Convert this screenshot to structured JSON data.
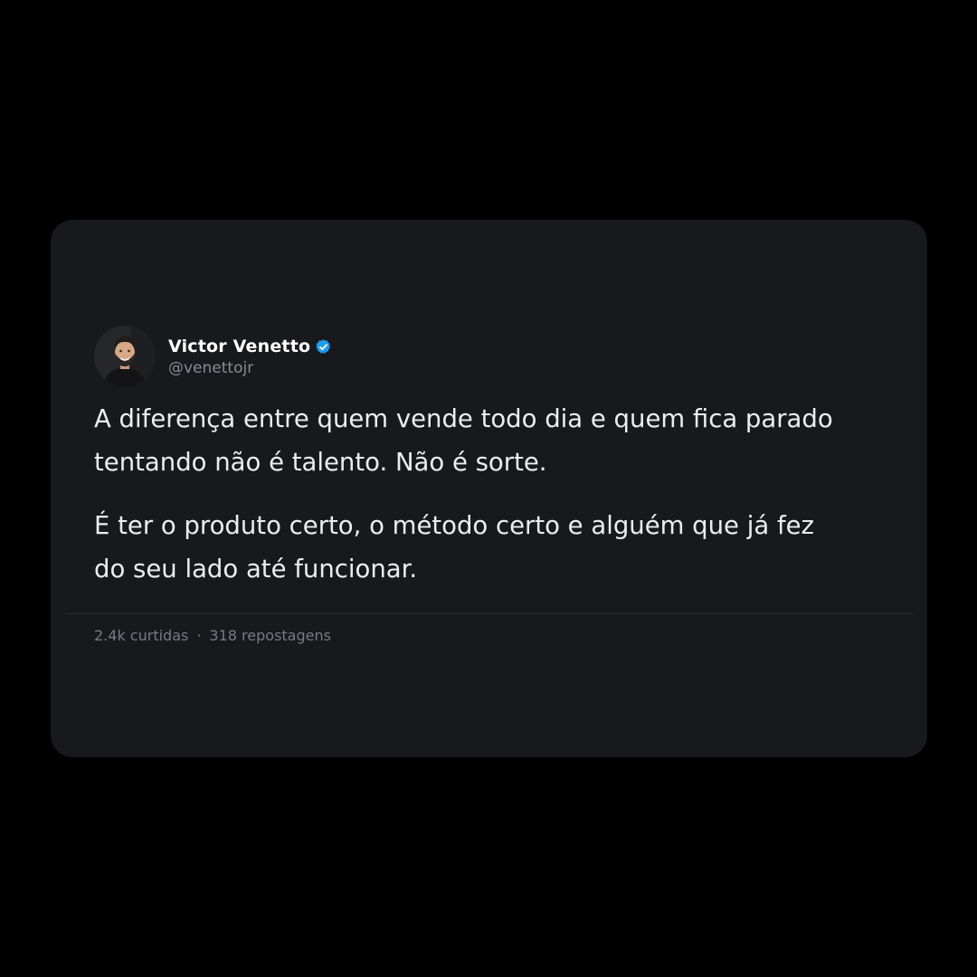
{
  "author": {
    "name": "Victor Venetto",
    "handle": "@venettojr",
    "verified": true,
    "verified_color": "#1d9bf0",
    "avatar_icon": "user-photo"
  },
  "post": {
    "paragraphs": [
      "A diferença entre quem vende todo dia e quem fica parado tentando não é talento. Não é sorte.",
      "É ter o produto certo, o método certo e alguém que já fez do seu lado até funcionar."
    ]
  },
  "stats": {
    "likes": "2.4k curtidas",
    "separator": "·",
    "reposts": "318 repostagens"
  },
  "colors": {
    "page_background": "#000000",
    "card_background": "#18191d",
    "text_primary": "#ededee",
    "text_secondary": "#8a8b90"
  }
}
